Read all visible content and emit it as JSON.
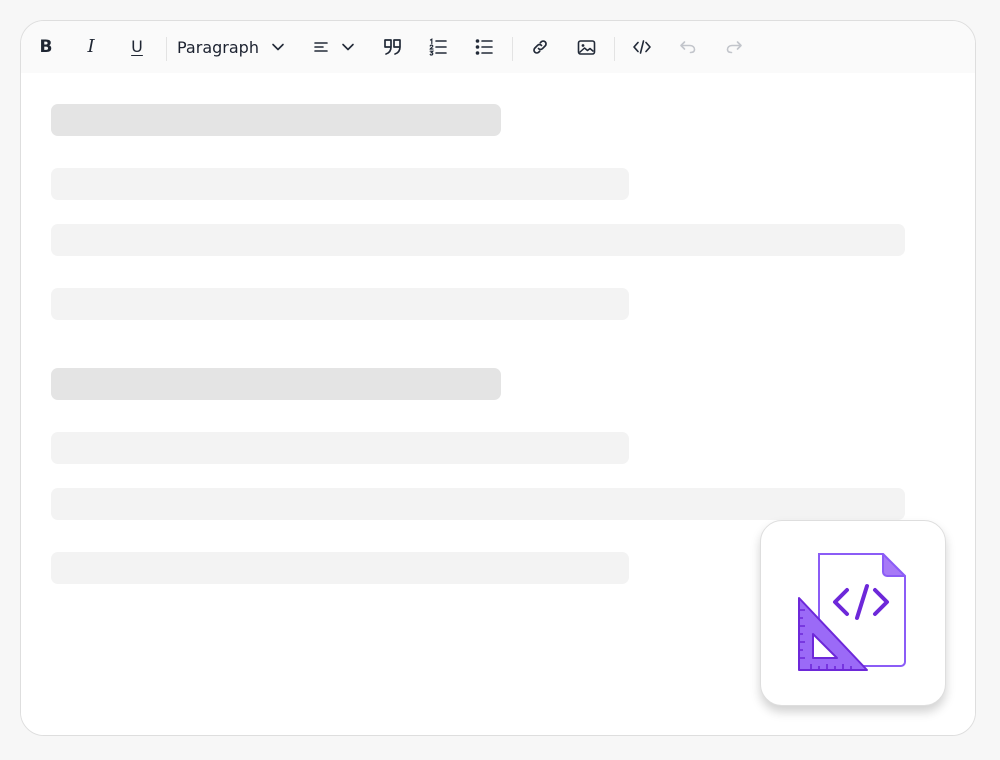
{
  "toolbar": {
    "bold": {
      "glyph": "B",
      "icon": "bold-icon"
    },
    "italic": {
      "glyph": "I",
      "icon": "italic-icon"
    },
    "underline": {
      "glyph": "U",
      "icon": "underline-icon"
    },
    "block_format": {
      "selected": "Paragraph",
      "icon": "chevron-down-icon"
    },
    "align": {
      "icon": "align-left-icon"
    },
    "quote": {
      "icon": "quote-icon"
    },
    "ordered_list": {
      "icon": "ordered-list-icon"
    },
    "bullet_list": {
      "icon": "bullet-list-icon"
    },
    "link": {
      "icon": "link-icon"
    },
    "image": {
      "icon": "image-icon"
    },
    "code": {
      "icon": "code-icon"
    },
    "undo": {
      "icon": "undo-icon",
      "enabled": false
    },
    "redo": {
      "icon": "redo-icon",
      "enabled": false
    }
  },
  "content": {
    "placeholder_lines": [
      {
        "kind": "heading"
      },
      {
        "kind": "text"
      },
      {
        "kind": "text"
      },
      {
        "kind": "text"
      },
      {
        "kind": "heading"
      },
      {
        "kind": "text"
      },
      {
        "kind": "text"
      },
      {
        "kind": "text"
      }
    ]
  },
  "badge": {
    "icon": "code-file-ruler-icon",
    "accent": "#8b5cf6",
    "accent_dark": "#6d28d9"
  },
  "colors": {
    "icon": "#222a38",
    "disabled_icon": "#c2c5cb",
    "heading_skeleton": "#e4e4e4",
    "text_skeleton": "#f3f3f3"
  }
}
